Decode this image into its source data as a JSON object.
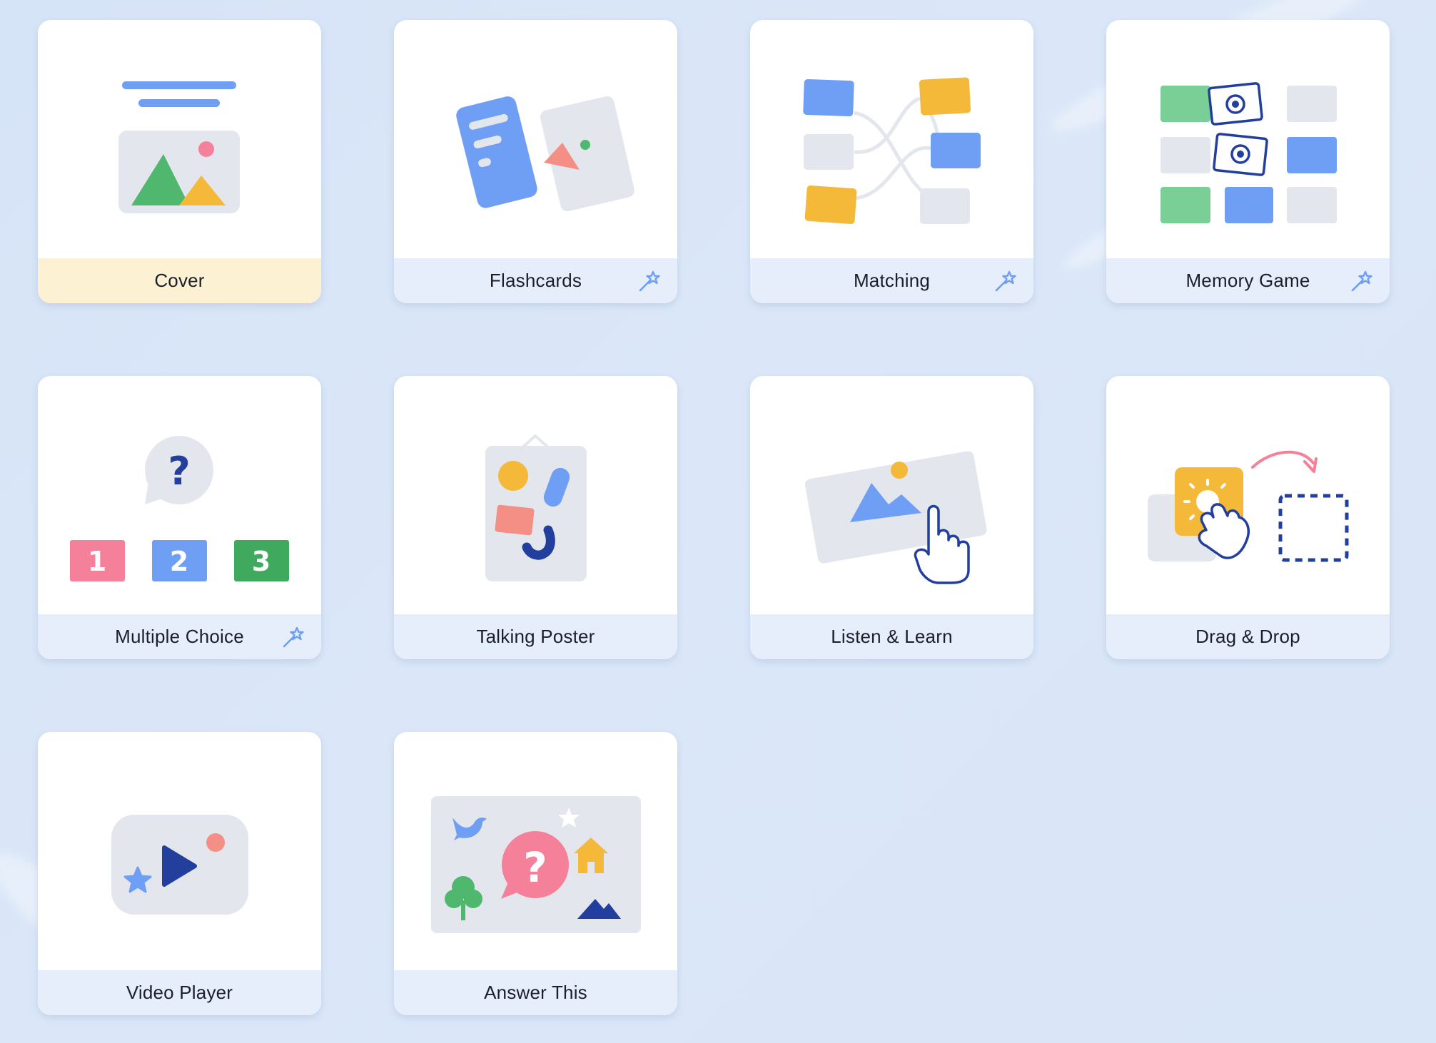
{
  "colors": {
    "background": "#d8e5f8",
    "card": "#ffffff",
    "footer": "#e7eefb",
    "cover_footer": "#fdf1d3",
    "blue": "#6e9ff5",
    "navy": "#233f9e",
    "green": "#4fb86e",
    "yellow": "#f5b93a",
    "pink": "#f5809a",
    "grey": "#e3e6ed"
  },
  "templates": [
    {
      "label": "Cover",
      "icon": "cover-illustration",
      "ai": false
    },
    {
      "label": "Flashcards",
      "icon": "flashcards-illustration",
      "ai": true
    },
    {
      "label": "Matching",
      "icon": "matching-illustration",
      "ai": true
    },
    {
      "label": "Memory Game",
      "icon": "memory-game-illustration",
      "ai": true
    },
    {
      "label": "Multiple Choice",
      "icon": "multiple-choice-illustration",
      "ai": true
    },
    {
      "label": "Talking Poster",
      "icon": "talking-poster-illustration",
      "ai": false
    },
    {
      "label": "Listen & Learn",
      "icon": "listen-learn-illustration",
      "ai": false
    },
    {
      "label": "Drag & Drop",
      "icon": "drag-drop-illustration",
      "ai": false
    },
    {
      "label": "Video Player",
      "icon": "video-player-illustration",
      "ai": false
    },
    {
      "label": "Answer This",
      "icon": "answer-this-illustration",
      "ai": false
    }
  ],
  "multiple_choice_options": [
    "1",
    "2",
    "3"
  ],
  "question_mark": "?"
}
